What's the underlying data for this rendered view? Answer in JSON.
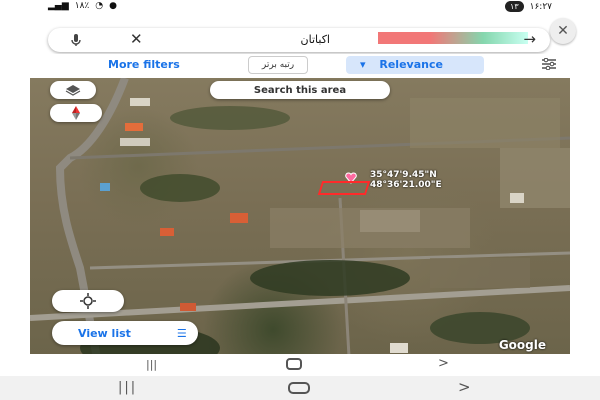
{
  "status_bar": {
    "left_text": "۱۸٪",
    "left_pill": "۱۳",
    "right_text": "۱۶:۲۷"
  },
  "search": {
    "query": "اکباتان",
    "clear_icon": "close-icon",
    "back_icon": "arrow-right-icon",
    "mic_icon": "mic-icon"
  },
  "filters": {
    "more_filters_label": "More filters",
    "rank_chip_label": "رتبه برتر",
    "relevance_label": "Relevance",
    "relevance_arrow": "▾",
    "tune_icon": "tune-icon"
  },
  "map": {
    "search_area_label": "Search this area",
    "coord_line1": "35°47'9.45\"N",
    "coord_line2": "48°36'21.00\"E",
    "google_label": "Google",
    "view_list_label": "View list",
    "list_icon": "☰"
  },
  "colors": {
    "accent": "#1a73e8",
    "marker": "#ff2a2a"
  }
}
